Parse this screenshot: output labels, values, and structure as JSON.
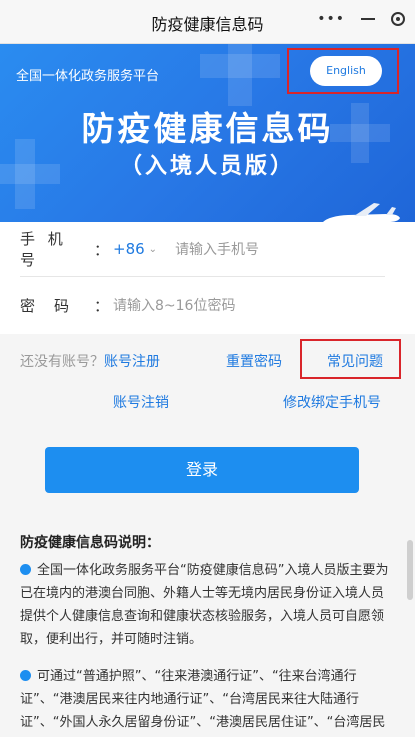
{
  "window": {
    "title": "防疫健康信息码",
    "controls": [
      "more-icon",
      "minimize-icon",
      "close-circle-icon"
    ]
  },
  "banner": {
    "platform": "全国一体化政务服务平台",
    "english_button": "English",
    "title": "防疫健康信息码",
    "subtitle": "（入境人员版）"
  },
  "form": {
    "phone_label": "手 机 号",
    "phone_colon": "：",
    "country_code": "+86",
    "phone_placeholder": "请输入手机号",
    "password_label": "密　码",
    "password_colon": "：",
    "password_placeholder": "请输入8~16位密码"
  },
  "links": {
    "no_account": "还没有账号？",
    "register": "账号注册",
    "reset_password": "重置密码",
    "faq": "常见问题",
    "cancel_account": "账号注销",
    "modify_phone": "修改绑定手机号"
  },
  "login_button": "登录",
  "description": {
    "heading": "防疫健康信息码说明：",
    "p1": "全国一体化政务服务平台“防疫健康信息码”入境人员版主要为已在境内的港澳台同胞、外籍人士等无境内居民身份证入境人员提供个人健康信息查询和健康状态核验服务，入境人员可自愿领取，便利出行，并可随时注销。",
    "p2": "可通过“普通护照”、“往来港澳通行证”、“往来台湾通行证”、“港澳居民来往内地通行证”、“台湾居民来往大陆通行证”、“外国人永久居留身份证”、“港澳居民居住证”、“台湾居民"
  },
  "colors": {
    "accent": "#1d8ef0",
    "highlight": "#d9252a"
  }
}
